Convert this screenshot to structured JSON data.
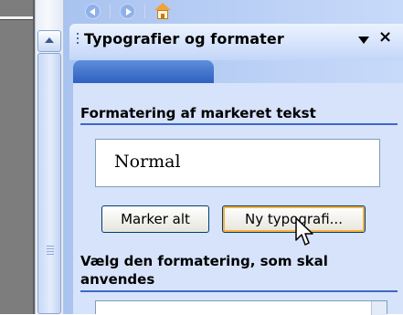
{
  "task_pane": {
    "title": "Typografier og formater",
    "section_selected": "Formatering af markeret tekst",
    "current_style": "Normal",
    "buttons": {
      "select_all": "Marker alt",
      "new_style": "Ny typografi..."
    },
    "section_apply": "Vælg den formatering, som skal anvendes"
  },
  "icons": {
    "nav_back": "back-arrow-icon",
    "nav_forward": "forward-arrow-icon",
    "nav_home": "home-icon",
    "pane_options": "dropdown-triangle-icon",
    "pane_close": "close-icon",
    "scroll_up": "chevron-up-icon",
    "cursor": "mouse-pointer-icon"
  },
  "colors": {
    "pane_content_bg": "#d6e3fb",
    "nav_bar": "#2e60c2",
    "section_rule": "#3e68c4",
    "button_hover": "#f8b23e"
  }
}
